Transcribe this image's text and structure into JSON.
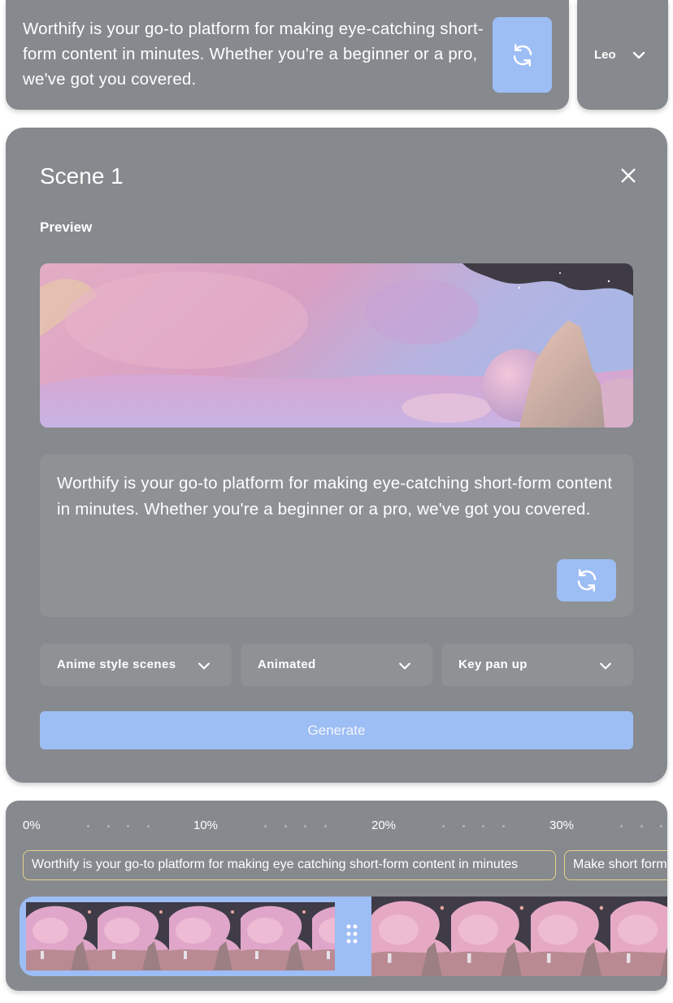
{
  "header": {
    "prompt_text": "Worthify is your go-to platform for making eye-catching short-form content in minutes. Whether you're a beginner or a pro, we've got you covered.",
    "refresh_icon": "refresh-icon",
    "user_name": "Leo",
    "user_chevron_icon": "chevron-down-icon"
  },
  "scene": {
    "title": "Scene 1",
    "preview_label": "Preview",
    "script_text": "Worthify is your go-to platform for making eye-catching short-form content in minutes. Whether you're a beginner or a pro, we've got you covered.",
    "dropdowns": [
      {
        "label": "Anime style scenes"
      },
      {
        "label": "Animated"
      },
      {
        "label": "Key pan up"
      }
    ],
    "generate_label": "Generate"
  },
  "timeline": {
    "ticks": [
      "0%",
      "10%",
      "20%",
      "30%"
    ],
    "captions": [
      "Worthify is your go-to platform for making eye catching short-form content in minutes",
      "Make short form"
    ]
  },
  "colors": {
    "overlay_gray": "#86898d",
    "accent_blue": "#9dbdf5",
    "caption_border": "#e4d28c"
  }
}
